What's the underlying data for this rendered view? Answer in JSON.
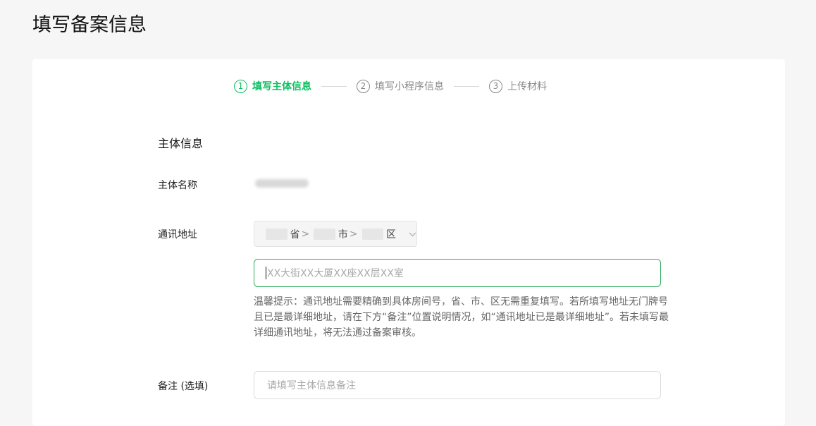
{
  "page": {
    "title": "填写备案信息"
  },
  "stepper": {
    "steps": [
      {
        "num": "1",
        "label": "填写主体信息",
        "active": true
      },
      {
        "num": "2",
        "label": "填写小程序信息",
        "active": false
      },
      {
        "num": "3",
        "label": "上传材料",
        "active": false
      }
    ]
  },
  "form": {
    "section_title": "主体信息",
    "subject_name_label": "主体名称",
    "address_label": "通讯地址",
    "region": {
      "province_suffix": "省",
      "city_suffix": "市",
      "district_suffix": "区",
      "arrow": ">"
    },
    "address_placeholder": "XX大街XX大厦XX座XX层XX室",
    "tip": "温馨提示：通讯地址需要精确到具体房间号，省、市、区无需重复填写。若所填写地址无门牌号且已是最详细地址，请在下方“备注”位置说明情况，如“通讯地址已是最详细地址”。若未填写最详细通讯地址，将无法通过备案审核。",
    "note_label": "备注 (选填)",
    "note_placeholder": "请填写主体信息备注"
  },
  "colors": {
    "accent": "#07c160",
    "focus_border": "#2dae5a"
  }
}
